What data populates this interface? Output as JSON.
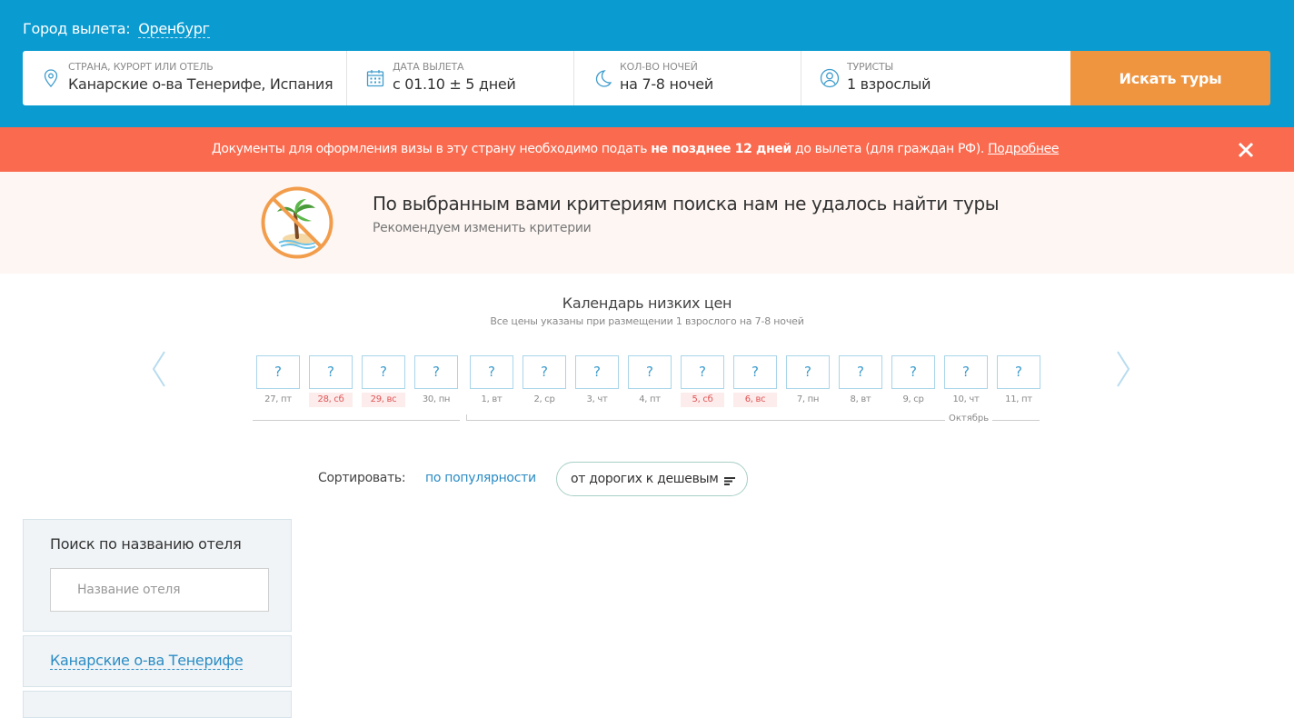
{
  "header": {
    "city_label": "Город вылета:",
    "city_value": "Оренбург",
    "fields": [
      {
        "icon": "location-pin-icon",
        "label": "Страна, курорт или отель",
        "value": "Канарские о-ва Тенерифе, Испания"
      },
      {
        "icon": "calendar-icon",
        "label": "Дата вылета",
        "value": "с 01.10 ± 5 дней"
      },
      {
        "icon": "moon-icon",
        "label": "Кол-во ночей",
        "value": "на 7-8 ночей"
      },
      {
        "icon": "user-icon",
        "label": "Туристы",
        "value": "1 взрослый"
      }
    ],
    "search_button": "Искать туры",
    "colors": {
      "header_bg": "#0a9bd1",
      "button_bg": "#ef9540"
    }
  },
  "alert": {
    "text_before": "Документы для оформления визы в эту страну необходимо подать ",
    "text_bold": "не позднее 12 дней",
    "text_after": " до вылета (для граждан РФ). ",
    "link": "Подробнее",
    "bg": "#fa6a4f"
  },
  "not_found": {
    "icon": "no-palm-island-icon",
    "title": "По выбранным вами критериям поиска нам не удалось найти туры",
    "subtitle": "Рекомендуем изменить критерии"
  },
  "calendar": {
    "title": "Календарь низких цен",
    "subtitle": "Все цены указаны при размещении 1 взрослого на 7-8 ночей",
    "days": [
      {
        "price": "?",
        "label": "27, пт",
        "weekend": false
      },
      {
        "price": "?",
        "label": "28, сб",
        "weekend": true
      },
      {
        "price": "?",
        "label": "29, вс",
        "weekend": true
      },
      {
        "price": "?",
        "label": "30, пн",
        "weekend": false
      },
      {
        "price": "?",
        "label": "1, вт",
        "weekend": false
      },
      {
        "price": "?",
        "label": "2, ср",
        "weekend": false
      },
      {
        "price": "?",
        "label": "3, чт",
        "weekend": false
      },
      {
        "price": "?",
        "label": "4, пт",
        "weekend": false
      },
      {
        "price": "?",
        "label": "5, сб",
        "weekend": true
      },
      {
        "price": "?",
        "label": "6, вс",
        "weekend": true
      },
      {
        "price": "?",
        "label": "7, пн",
        "weekend": false
      },
      {
        "price": "?",
        "label": "8, вт",
        "weekend": false
      },
      {
        "price": "?",
        "label": "9, ср",
        "weekend": false
      },
      {
        "price": "?",
        "label": "10, чт",
        "weekend": false
      },
      {
        "price": "?",
        "label": "11, пт",
        "weekend": false
      }
    ],
    "month_label": "Октябрь"
  },
  "sort": {
    "label": "Сортировать:",
    "popularity": "по популярности",
    "price_order": "от дорогих к дешевым"
  },
  "sidebar": {
    "hotel_search_title": "Поиск по названию отеля",
    "hotel_search_placeholder": "Название отеля",
    "region_link": "Канарские о-ва Тенерифе"
  }
}
